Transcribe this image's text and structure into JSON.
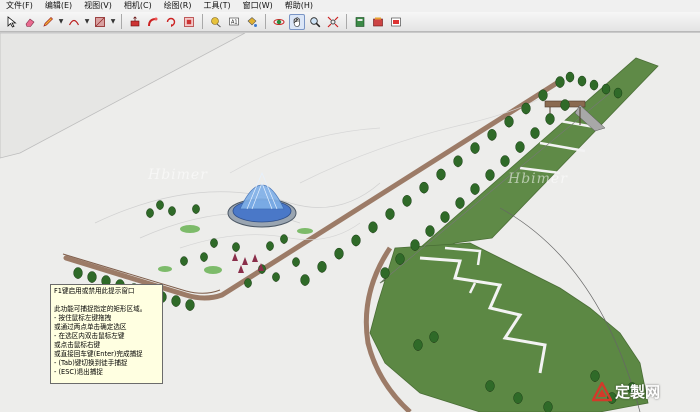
{
  "menu": [
    "文件(F)",
    "编辑(E)",
    "视图(V)",
    "相机(C)",
    "绘图(R)",
    "工具(T)",
    "窗口(W)",
    "帮助(H)"
  ],
  "toolbar": {
    "tools": [
      "select-tool",
      "eraser-tool",
      "pencil-tool",
      "arc-tool",
      "rectangle-tool",
      "push-pull-tool",
      "follow-me-tool",
      "rotate-tool",
      "offset-tool",
      "tape-measure-tool",
      "text-tool",
      "paint-bucket-tool",
      "orbit-tool",
      "pan-tool",
      "zoom-tool",
      "zoom-extents-tool",
      "components-tool",
      "materials-tool",
      "styles-tool"
    ],
    "active_tool": "pan-tool"
  },
  "viewport": {
    "watermarks": [
      "Hbimer",
      "Hbimer"
    ]
  },
  "tooltip": {
    "lines": [
      "F1键启用或禁用此提示窗口",
      "",
      "此功能可捕捉指定的矩形区域。",
      "- 按住鼠标左键拖拽",
      "  或通过两点单击确定选区",
      "- 在选区内双击鼠标左键",
      "  或点击鼠标右键",
      "  或直接回车键(Enter)完成捕捉",
      "- (Tab)键切换到徒手捕捉",
      "- (ESC)退出捕捉"
    ]
  },
  "brand": {
    "text": "定製网"
  },
  "colors": {
    "ground": "#ededeb",
    "lawn": "#5f8a47",
    "path": "#9c7b67",
    "tree": "#2f6a28",
    "tooltip_bg": "#ffffe1",
    "fountain": "#4a78c8"
  }
}
